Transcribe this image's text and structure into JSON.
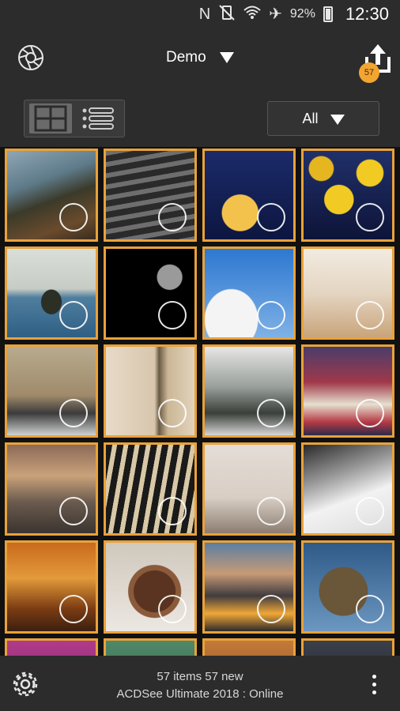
{
  "status": {
    "battery": "92%",
    "time": "12:30"
  },
  "header": {
    "title": "Demo",
    "upload_count": "57"
  },
  "toolbar": {
    "filter_label": "All"
  },
  "footer": {
    "counts": "57 items  57 new",
    "status": "ACDSee Ultimate 2018 : Online"
  },
  "photos": [
    {
      "name": "coast-cliff"
    },
    {
      "name": "water-swan"
    },
    {
      "name": "yellow-tulip"
    },
    {
      "name": "yellow-tulips"
    },
    {
      "name": "island-sea"
    },
    {
      "name": "full-moon"
    },
    {
      "name": "bird-sky"
    },
    {
      "name": "white-hall"
    },
    {
      "name": "old-buildings-cars"
    },
    {
      "name": "door-wall"
    },
    {
      "name": "snowy-trees-cabin"
    },
    {
      "name": "totem-face"
    },
    {
      "name": "sunset-hills"
    },
    {
      "name": "tower-windows"
    },
    {
      "name": "person-beach"
    },
    {
      "name": "snow-slope"
    },
    {
      "name": "autumn-forest"
    },
    {
      "name": "chocolate-cake"
    },
    {
      "name": "city-lights-dusk"
    },
    {
      "name": "bare-tree-sky"
    }
  ],
  "colors": {
    "accent": "#e8a23a",
    "badge": "#f2a531",
    "bar": "#2c2c2c"
  }
}
